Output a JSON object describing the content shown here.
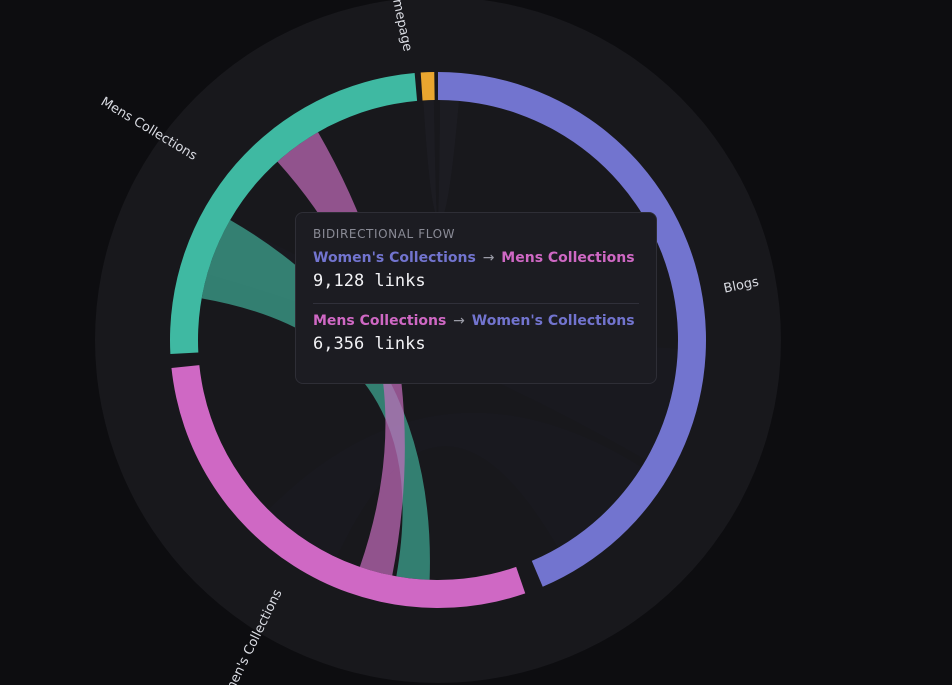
{
  "colors": {
    "background": "#0d0d10",
    "halo": "#18181c",
    "tooltip_bg": "#1c1c22",
    "blogs": "#7274cf",
    "womens": "#cf68c4",
    "mens": "#3fb9a2",
    "homepage": "#eaa62f"
  },
  "chart_data": {
    "type": "chord",
    "groups": [
      {
        "name": "Blogs",
        "label": "Blogs",
        "color": "#7274cf"
      },
      {
        "name": "Women's Collections",
        "label": "Women's Collections",
        "color": "#cf68c4"
      },
      {
        "name": "Mens Collections",
        "label": "Mens Collections",
        "color": "#3fb9a2"
      },
      {
        "name": "Homepage",
        "label": "Homepage",
        "color": "#eaa62f"
      }
    ],
    "highlighted_flow": {
      "between": [
        "Women's Collections",
        "Mens Collections"
      ]
    }
  },
  "tooltip": {
    "heading": "BIDIRECTIONAL FLOW",
    "rows": [
      {
        "from": "Women's Collections",
        "arrow": "→",
        "to": "Mens Collections",
        "count": "9,128 links"
      },
      {
        "from": "Mens Collections",
        "arrow": "→",
        "to": "Women's Collections",
        "count": "6,356 links"
      }
    ]
  }
}
